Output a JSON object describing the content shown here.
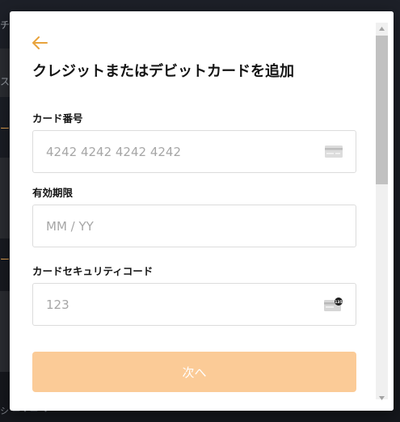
{
  "background": {
    "snippets": [
      "チュ",
      "スタ",
      "ー",
      "ー"
    ],
    "bottom_text": "シ ー・ー ・"
  },
  "modal": {
    "title": "クレジットまたはデビットカードを追加",
    "card_number": {
      "label": "カード番号",
      "placeholder": "4242 4242 4242 4242"
    },
    "expiry": {
      "label": "有効期限",
      "placeholder": "MM / YY"
    },
    "cvc": {
      "label": "カードセキュリティコード",
      "placeholder": "123",
      "badge": "135"
    },
    "next_label": "次へ"
  },
  "colors": {
    "accent": "#e8a33c",
    "button": "#fbcb97",
    "backdrop": "#1a1d24"
  },
  "icons": {
    "back": "arrow-left-icon",
    "card": "credit-card-icon",
    "cvc": "card-cvc-icon"
  }
}
